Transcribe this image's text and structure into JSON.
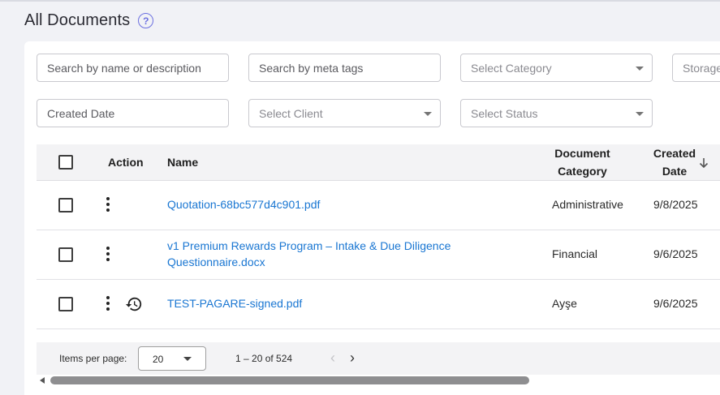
{
  "page": {
    "title": "All Documents",
    "help_icon": "question-circle-icon"
  },
  "filters": {
    "search_name_placeholder": "Search by name or description",
    "search_meta_placeholder": "Search by meta tags",
    "category_placeholder": "Select Category",
    "storage_placeholder": "Storage",
    "created_date_placeholder": "Created Date",
    "client_placeholder": "Select Client",
    "status_placeholder": "Select Status"
  },
  "table": {
    "headers": {
      "action": "Action",
      "name": "Name",
      "category_line1": "Document",
      "category_line2": "Category",
      "created_line1": "Created",
      "created_line2": "Date",
      "sort_icon": "arrow-down-icon"
    },
    "rows": [
      {
        "name": "Quotation-68bc577d4c901.pdf",
        "category": "Administrative",
        "created": "9/8/2025"
      },
      {
        "name_line1": "v1 Premium Rewards Program – Intake & Due Diligence",
        "name_line2": "Questionnaire.docx",
        "category": "Financial",
        "created": "9/6/2025"
      },
      {
        "name": "TEST-PAGARE-signed.pdf",
        "category": "Ayşe",
        "created": "9/6/2025",
        "history_icon": "history-icon"
      }
    ]
  },
  "paginator": {
    "items_per_page_label": "Items per page:",
    "page_size": "20",
    "range": "1 – 20 of 524",
    "prev": "‹",
    "next": "›"
  },
  "colors": {
    "accent": "#6b6fe0",
    "link": "#1976d2",
    "background": "#f1f2f6"
  }
}
